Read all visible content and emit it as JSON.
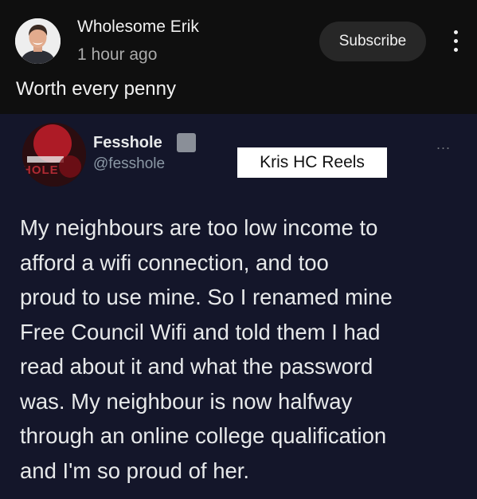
{
  "post": {
    "channel_name": "Wholesome Erik",
    "time": "1 hour ago",
    "subscribe_label": "Subscribe",
    "caption": "Worth every penny",
    "avatar_icon": "person-photo"
  },
  "tweet": {
    "name": "Fesshole",
    "handle": "@fesshole",
    "avatar_text": "HOLE",
    "more_label": "...",
    "watermark": "Kris HC Reels",
    "lines": [
      "My neighbours are too low income to",
      "afford a wifi connection, and too",
      "proud to use mine. So I renamed mine",
      "Free Council Wifi and told them I had",
      "read about it and what the password",
      "was. My neighbour is now halfway",
      "through an online college qualification",
      "and I'm so proud of her."
    ]
  },
  "colors": {
    "header_bg": "#0f0f0f",
    "tweet_bg": "#14162a",
    "subscribe_bg": "#272727",
    "avatar_red": "#b02a33"
  }
}
